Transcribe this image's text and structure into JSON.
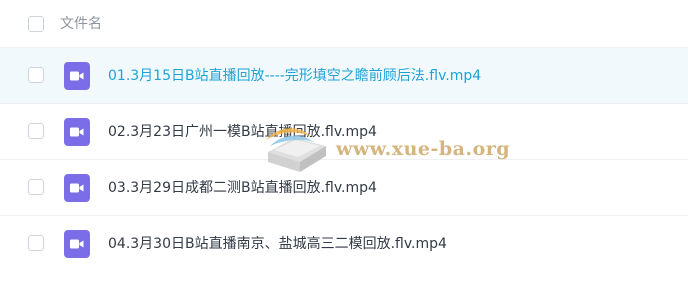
{
  "header": {
    "column_label": "文件名"
  },
  "files": [
    {
      "name": "01.3月15日B站直播回放----完形填空之瞻前顾后法.flv.mp4",
      "icon": "video-file-icon",
      "selected": true
    },
    {
      "name": "02.3月23日广州一模B站直播回放.flv.mp4",
      "icon": "video-file-icon",
      "selected": false
    },
    {
      "name": "03.3月29日成都二测B站直播回放.flv.mp4",
      "icon": "video-file-icon",
      "selected": false
    },
    {
      "name": "04.3月30日B站直播南京、盐城高三二模回放.flv.mp4",
      "icon": "video-file-icon",
      "selected": false
    }
  ],
  "watermark": {
    "text": "www.xue-ba.org"
  },
  "colors": {
    "icon_bg": "#7b6de8",
    "selected_text": "#1ea3d6",
    "selected_row_bg": "#f2f9fd"
  }
}
